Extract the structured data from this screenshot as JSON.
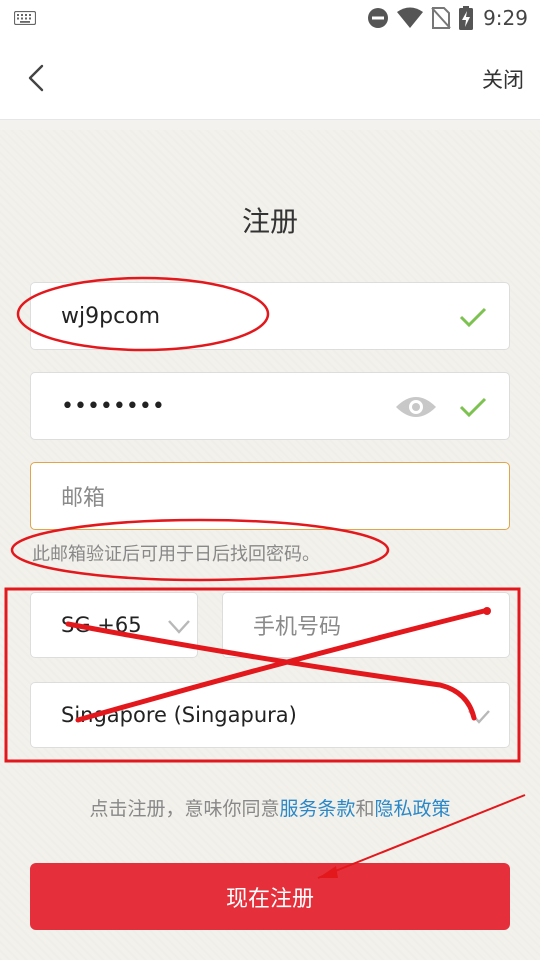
{
  "status_bar": {
    "time": "9:29",
    "icons": [
      "keyboard-icon",
      "dnd-icon",
      "wifi-icon",
      "no-sim-icon",
      "battery-icon"
    ]
  },
  "nav": {
    "back_icon": "chevron-left-icon",
    "close_label": "关闭"
  },
  "page": {
    "title": "注册",
    "username_value": "wj9pcom",
    "password_value": "••••••••",
    "email_placeholder": "邮箱",
    "email_hint": "此邮箱验证后可用于日后找回密码。",
    "country_code": "SG +65",
    "phone_placeholder": "手机号码",
    "country_name": "Singapore (Singapura)",
    "agree_prefix": "点击注册，意味你同意",
    "terms_link": "服务条款",
    "agree_and": "和",
    "privacy_link": "隐私政策",
    "register_button": "现在注册"
  },
  "colors": {
    "accent_red": "#e5303b",
    "check_green": "#7cc24f",
    "focus_border": "#e0a44a",
    "link_blue": "#2a88c8",
    "annotation_red": "#e3181c"
  }
}
